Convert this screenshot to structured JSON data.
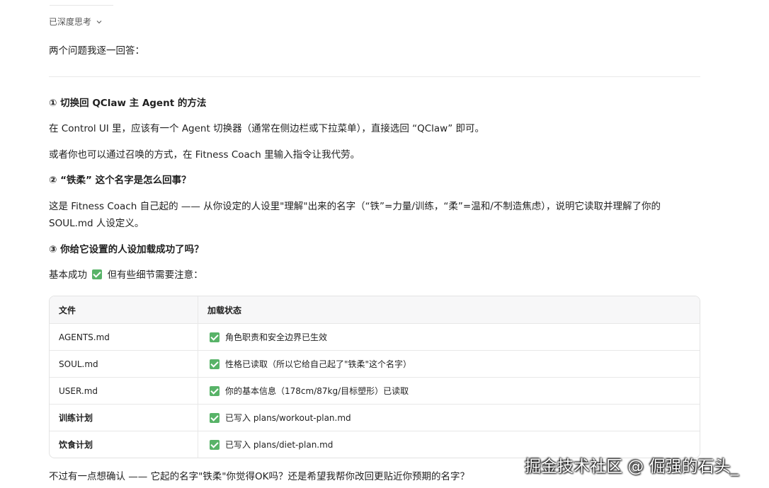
{
  "thinking": {
    "label": "已深度思考"
  },
  "intro": "两个问题我逐一回答：",
  "section1": {
    "heading": "① 切换回 QClaw 主 Agent 的方法",
    "p1": "在 Control UI 里，应该有一个 Agent 切换器（通常在侧边栏或下拉菜单），直接选回 “QClaw” 即可。",
    "p2": "或者你也可以通过召唤的方式，在 Fitness Coach 里输入指令让我代劳。"
  },
  "section2": {
    "heading": "② “铁柔” 这个名字是怎么回事？",
    "p1_line1": "这是 Fitness Coach 自己起的 —— 从你设定的人设里\"理解\"出来的名字（“铁”=力量/训练，“柔”=温和/不制造焦虑），说明它读取并理解了你的",
    "p1_line2": "SOUL.md 人设定义。"
  },
  "section3": {
    "heading": "③ 你给它设置的人设加载成功了吗？",
    "p1_before": "基本成功",
    "p1_after": "但有些细节需要注意："
  },
  "table": {
    "headers": [
      "文件",
      "加载状态"
    ],
    "rows": [
      {
        "file": "AGENTS.md",
        "status": "角色职责和安全边界已生效"
      },
      {
        "file": "SOUL.md",
        "status": "性格已读取（所以它给自己起了\"铁柔\"这个名字）"
      },
      {
        "file": "USER.md",
        "status": "你的基本信息（178cm/87kg/目标塑形）已读取"
      },
      {
        "file": "训练计划",
        "status": "已写入 plans/workout-plan.md"
      },
      {
        "file": "饮食计划",
        "status": "已写入 plans/diet-plan.md"
      }
    ]
  },
  "closing": "不过有一点想确认 —— 它起的名字\"铁柔\"你觉得OK吗？还是希望我帮你改回更贴近你预期的名字？",
  "watermark": "掘金技术社区 @ 倔强的石头_",
  "colors": {
    "check": "#58b368"
  }
}
